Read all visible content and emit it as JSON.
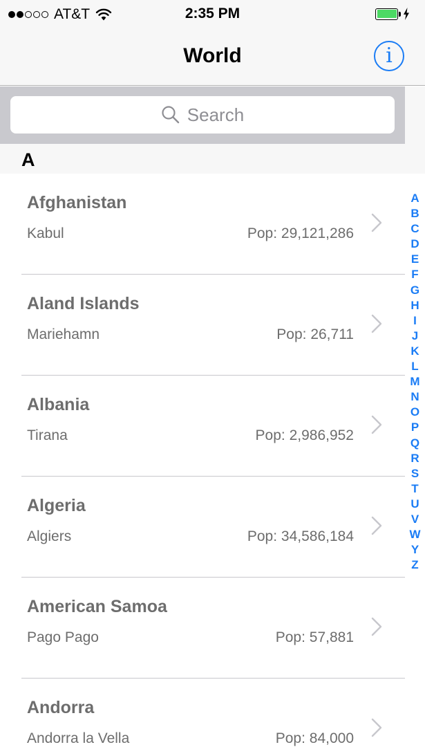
{
  "status_bar": {
    "carrier": "AT&T",
    "time": "2:35 PM",
    "signal_filled": 2,
    "signal_total": 5,
    "battery_level": 1.0,
    "battery_color": "#4cd964"
  },
  "nav": {
    "title": "World",
    "info_glyph": "i"
  },
  "search": {
    "placeholder": "Search"
  },
  "section": {
    "letter": "A"
  },
  "rows": [
    {
      "country": "Afghanistan",
      "capital": "Kabul",
      "population": "Pop: 29,121,286"
    },
    {
      "country": "Aland Islands",
      "capital": "Mariehamn",
      "population": "Pop: 26,711"
    },
    {
      "country": "Albania",
      "capital": "Tirana",
      "population": "Pop: 2,986,952"
    },
    {
      "country": "Algeria",
      "capital": "Algiers",
      "population": "Pop: 34,586,184"
    },
    {
      "country": "American Samoa",
      "capital": "Pago Pago",
      "population": "Pop: 57,881"
    },
    {
      "country": "Andorra",
      "capital": "Andorra la Vella",
      "population": "Pop: 84,000"
    }
  ],
  "index_letters": [
    "A",
    "B",
    "C",
    "D",
    "E",
    "F",
    "G",
    "H",
    "I",
    "J",
    "K",
    "L",
    "M",
    "N",
    "O",
    "P",
    "Q",
    "R",
    "S",
    "T",
    "U",
    "V",
    "W",
    "Y",
    "Z"
  ],
  "colors": {
    "accent": "#1a7cf5",
    "row_text": "#6d6d6d",
    "search_bar_bg": "#c9c9ce"
  },
  "icons": {
    "signal": "signal-dots-icon",
    "wifi": "wifi-icon",
    "battery": "battery-icon",
    "charging": "charging-bolt-icon",
    "info": "info-icon",
    "search": "search-icon",
    "chevron": "chevron-right-icon"
  }
}
